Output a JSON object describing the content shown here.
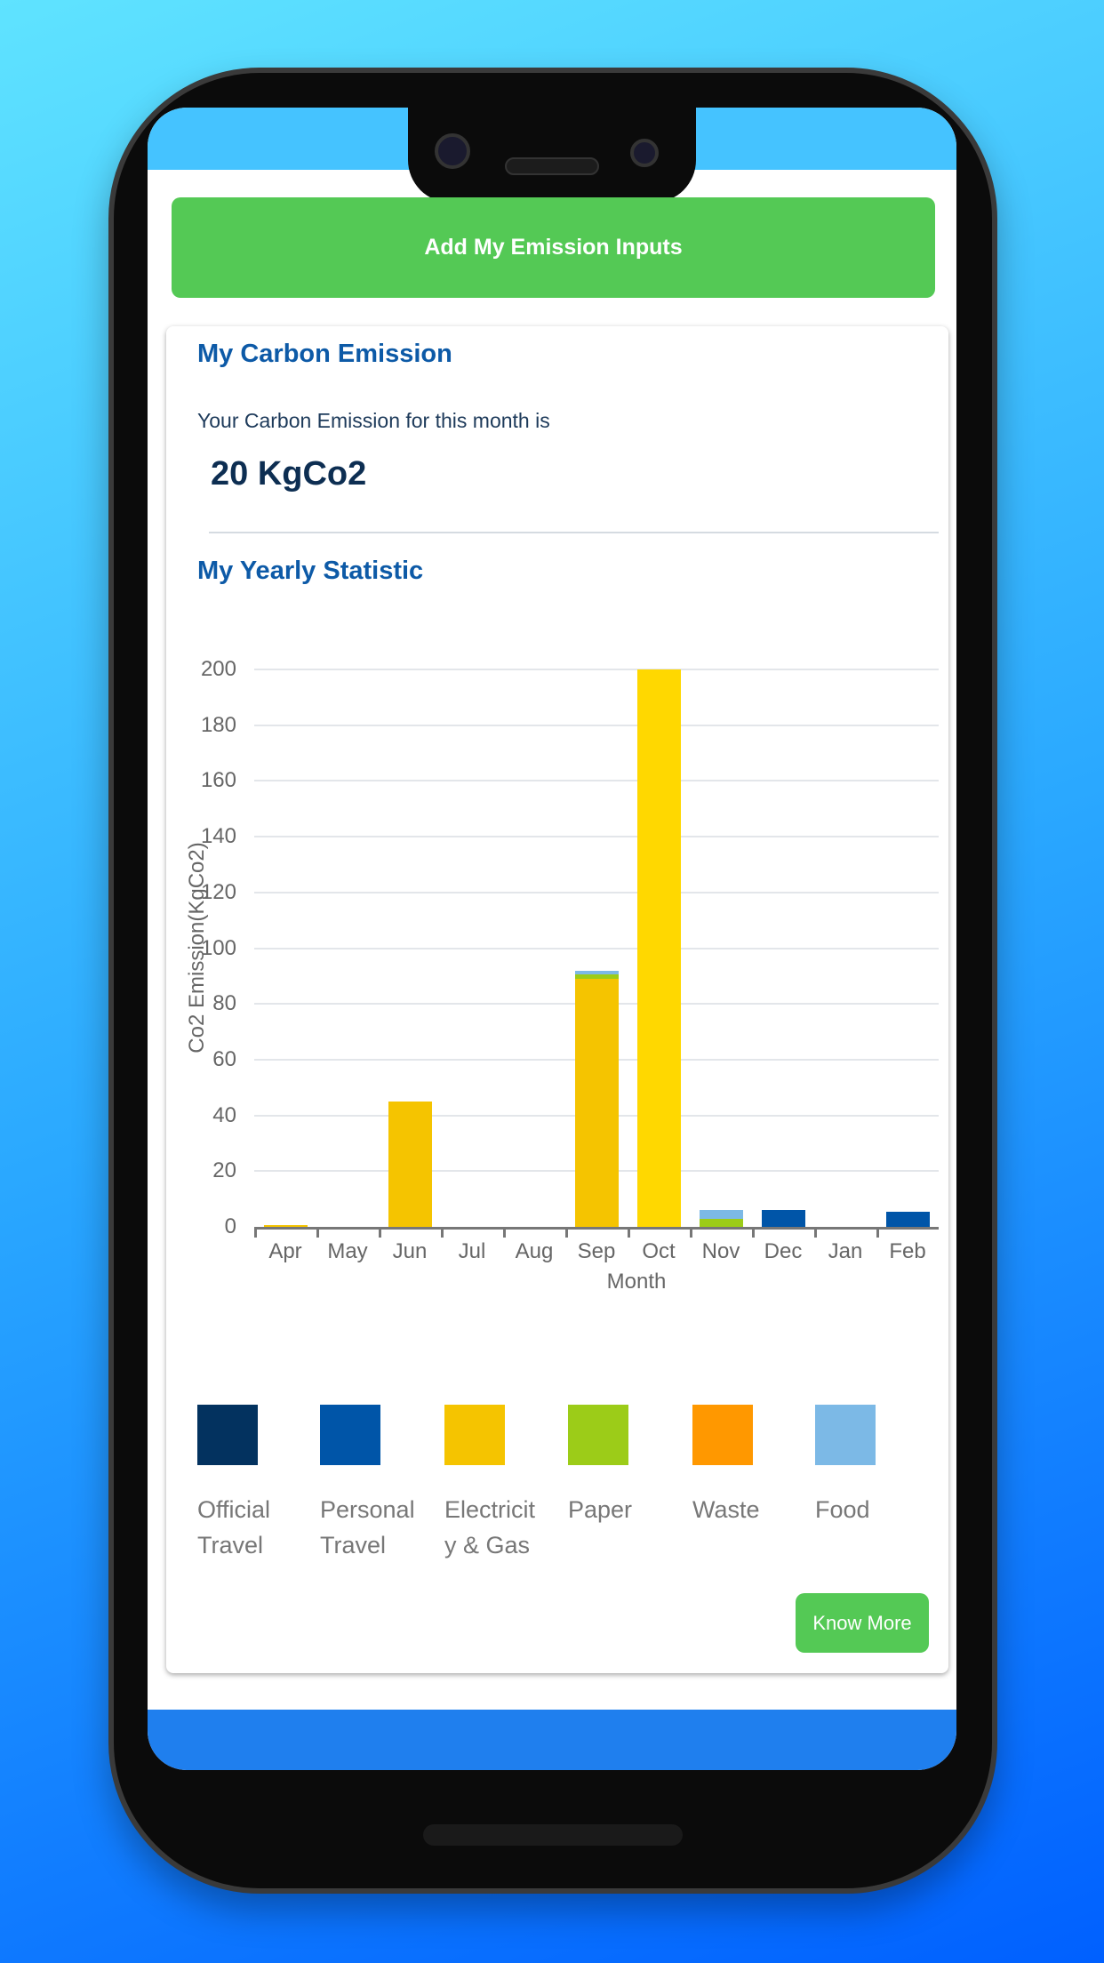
{
  "add_button": "Add My Emission Inputs",
  "carbon": {
    "title": "My Carbon Emission",
    "subtitle": "Your Carbon Emission for this month is",
    "value": "20 KgCo2"
  },
  "yearly_title": "My Yearly Statistic",
  "know_more": "Know More",
  "chart_data": {
    "type": "bar",
    "stacked": true,
    "xlabel": "Month",
    "ylabel": "Co2 Emission(KgCo2)",
    "ylim": [
      0,
      200
    ],
    "yticks": [
      0,
      20,
      40,
      60,
      80,
      100,
      120,
      140,
      160,
      180,
      200
    ],
    "grid": true,
    "categories": [
      "Apr",
      "May",
      "Jun",
      "Jul",
      "Aug",
      "Sep",
      "Oct",
      "Nov",
      "Dec",
      "Jan",
      "Feb"
    ],
    "series": [
      {
        "name": "Official Travel",
        "color": "#03325f",
        "values": [
          0,
          0,
          0,
          0,
          0,
          0,
          0,
          0,
          0,
          0,
          0
        ]
      },
      {
        "name": "Personal Travel",
        "color": "#0055a8",
        "values": [
          0,
          0,
          0,
          0,
          0,
          0,
          0,
          0,
          6,
          0,
          5.5
        ]
      },
      {
        "name": "Electricity & Gas",
        "color": "#f5c400",
        "values": [
          0.5,
          0,
          45,
          0,
          0,
          89,
          200,
          0,
          0,
          0,
          0
        ]
      },
      {
        "name": "Paper",
        "color": "#9ccc18",
        "values": [
          0,
          0,
          0,
          0,
          0,
          1.5,
          0,
          3,
          0,
          0,
          0
        ]
      },
      {
        "name": "Waste",
        "color": "#ff9800",
        "values": [
          0,
          0,
          0,
          0,
          0,
          0,
          0,
          0,
          0,
          0,
          0
        ]
      },
      {
        "name": "Food",
        "color": "#7cb9e6",
        "values": [
          0,
          0,
          0,
          0,
          0,
          1.5,
          0,
          3,
          0,
          0,
          0
        ]
      }
    ],
    "legend_placement": "bottom"
  },
  "legend_lines": [
    [
      "Official",
      "Travel"
    ],
    [
      "Personal",
      "Travel"
    ],
    [
      "Electricit",
      "y & Gas"
    ],
    [
      "Paper",
      ""
    ],
    [
      "Waste",
      ""
    ],
    [
      "Food",
      ""
    ]
  ]
}
